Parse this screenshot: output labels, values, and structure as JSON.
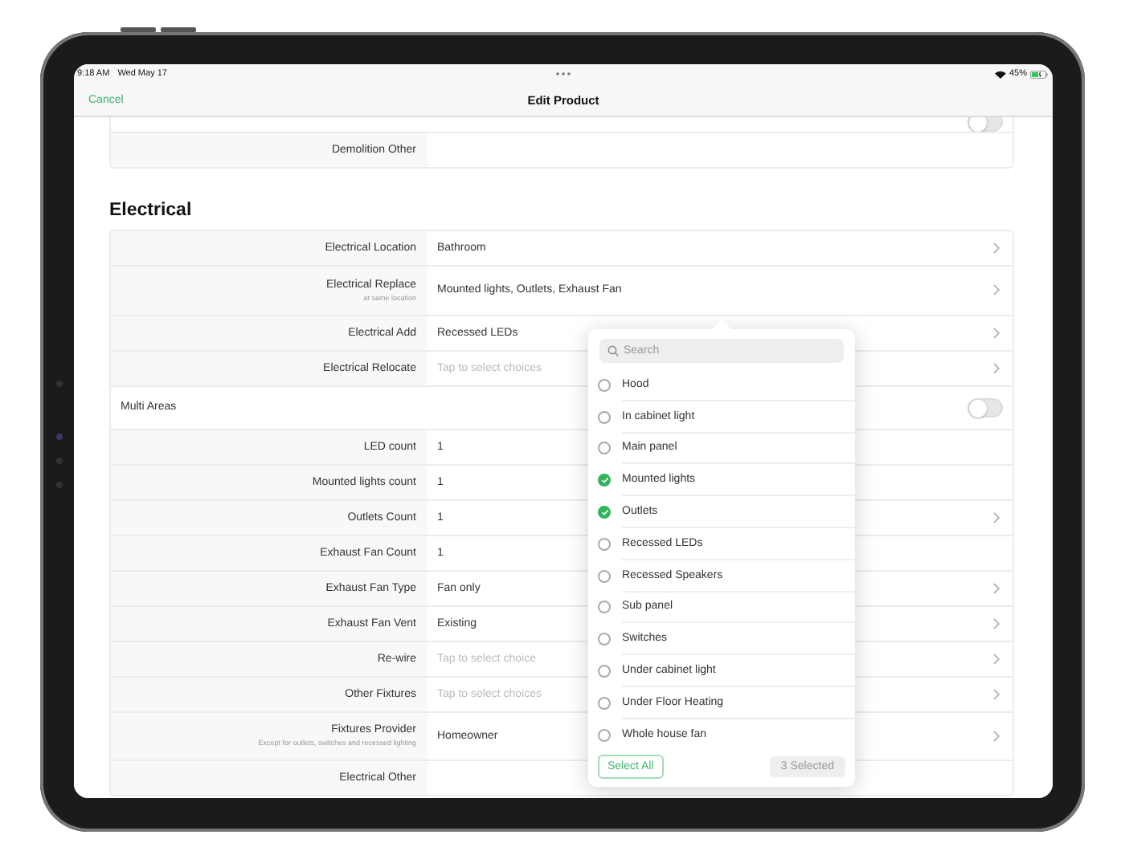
{
  "status_bar": {
    "time": "9:18 AM",
    "date": "Wed May 17",
    "battery": "45%"
  },
  "nav": {
    "cancel": "Cancel",
    "title": "Edit Product"
  },
  "top_rows": [
    {
      "kind": "toggle",
      "on": false
    },
    {
      "kind": "field",
      "label": "Demolition Other",
      "disclosure": false
    }
  ],
  "section": {
    "title": "Electrical",
    "rows": [
      {
        "kind": "field",
        "label": "Electrical Location",
        "value": "Bathroom",
        "disclosure": true
      },
      {
        "kind": "field",
        "label": "Electrical Replace",
        "sublabel": "at same location",
        "value": "Mounted lights, Outlets, Exhaust Fan",
        "disclosure": true
      },
      {
        "kind": "field",
        "label": "Electrical Add",
        "value": "Recessed LEDs",
        "disclosure": true
      },
      {
        "kind": "field",
        "label": "Electrical Relocate",
        "placeholder": "Tap to select choices",
        "disclosure": true
      },
      {
        "kind": "toggle",
        "label": "Multi Areas",
        "on": false
      },
      {
        "kind": "field",
        "label": "LED count",
        "value": "1",
        "disclosure": false
      },
      {
        "kind": "field",
        "label": "Mounted lights count",
        "value": "1",
        "disclosure": false
      },
      {
        "kind": "field",
        "label": "Outlets Count",
        "value": "1",
        "disclosure": true
      },
      {
        "kind": "field",
        "label": "Exhaust Fan Count",
        "value": "1",
        "disclosure": false
      },
      {
        "kind": "field",
        "label": "Exhaust Fan Type",
        "value": "Fan only",
        "disclosure": true
      },
      {
        "kind": "field",
        "label": "Exhaust Fan Vent",
        "value": "Existing",
        "disclosure": true
      },
      {
        "kind": "field",
        "label": "Re-wire",
        "placeholder": "Tap to select choice",
        "disclosure": true
      },
      {
        "kind": "field",
        "label": "Other Fixtures",
        "placeholder": "Tap to select choices",
        "disclosure": true
      },
      {
        "kind": "field",
        "label": "Fixtures Provider",
        "sublabel": "Except for outlets, switches and recessed lighting",
        "value": "Homeowner",
        "disclosure": true
      },
      {
        "kind": "field",
        "label": "Electrical Other",
        "disclosure": false
      }
    ]
  },
  "popover": {
    "search_placeholder": "Search",
    "options": [
      {
        "label": "Hood",
        "selected": false
      },
      {
        "label": "In cabinet light",
        "selected": false
      },
      {
        "label": "Main panel",
        "selected": false
      },
      {
        "label": "Mounted lights",
        "selected": true
      },
      {
        "label": "Outlets",
        "selected": true
      },
      {
        "label": "Recessed LEDs",
        "selected": false
      },
      {
        "label": "Recessed Speakers",
        "selected": false
      },
      {
        "label": "Sub panel",
        "selected": false
      },
      {
        "label": "Switches",
        "selected": false
      },
      {
        "label": "Under cabinet light",
        "selected": false
      },
      {
        "label": "Under Floor Heating",
        "selected": false
      },
      {
        "label": "Whole house fan",
        "selected": false
      }
    ],
    "select_all": "Select All",
    "count": "3 Selected"
  }
}
